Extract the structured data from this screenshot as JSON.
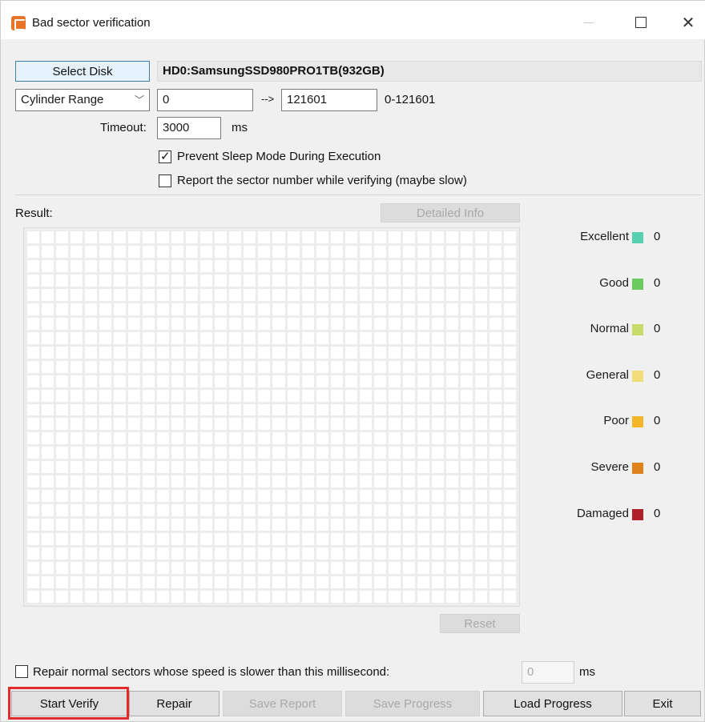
{
  "window": {
    "title": "Bad sector verification",
    "icon": "app-icon"
  },
  "disk": {
    "select_label": "Select Disk",
    "name": "HD0:SamsungSSD980PRO1TB(932GB)"
  },
  "range": {
    "mode": "Cylinder Range",
    "start": "0",
    "arrow": "-->",
    "end": "121601",
    "hint": "0-121601"
  },
  "timeout": {
    "label": "Timeout:",
    "value": "3000",
    "unit": "ms"
  },
  "options": {
    "prevent_sleep": {
      "label": "Prevent Sleep Mode During Execution",
      "checked": true
    },
    "report_sector": {
      "label": "Report the sector number while verifying (maybe slow)",
      "checked": false
    }
  },
  "result": {
    "label": "Result:",
    "detailed_info": "Detailed Info",
    "reset": "Reset"
  },
  "legend": [
    {
      "name": "Excellent",
      "color": "#57d0b0",
      "count": "0"
    },
    {
      "name": "Good",
      "color": "#6acc5f",
      "count": "0"
    },
    {
      "name": "Normal",
      "color": "#c6dc6a",
      "count": "0"
    },
    {
      "name": "General",
      "color": "#f1dc7a",
      "count": "0"
    },
    {
      "name": "Poor",
      "color": "#f3b52a",
      "count": "0"
    },
    {
      "name": "Severe",
      "color": "#e0821a",
      "count": "0"
    },
    {
      "name": "Damaged",
      "color": "#b21f2c",
      "count": "0"
    }
  ],
  "repair_option": {
    "label": "Repair normal sectors whose speed is slower than this millisecond:",
    "checked": false,
    "value": "0",
    "unit": "ms"
  },
  "buttons": {
    "start_verify": "Start Verify",
    "repair": "Repair",
    "save_report": "Save Report",
    "save_progress": "Save Progress",
    "load_progress": "Load Progress",
    "exit": "Exit"
  }
}
